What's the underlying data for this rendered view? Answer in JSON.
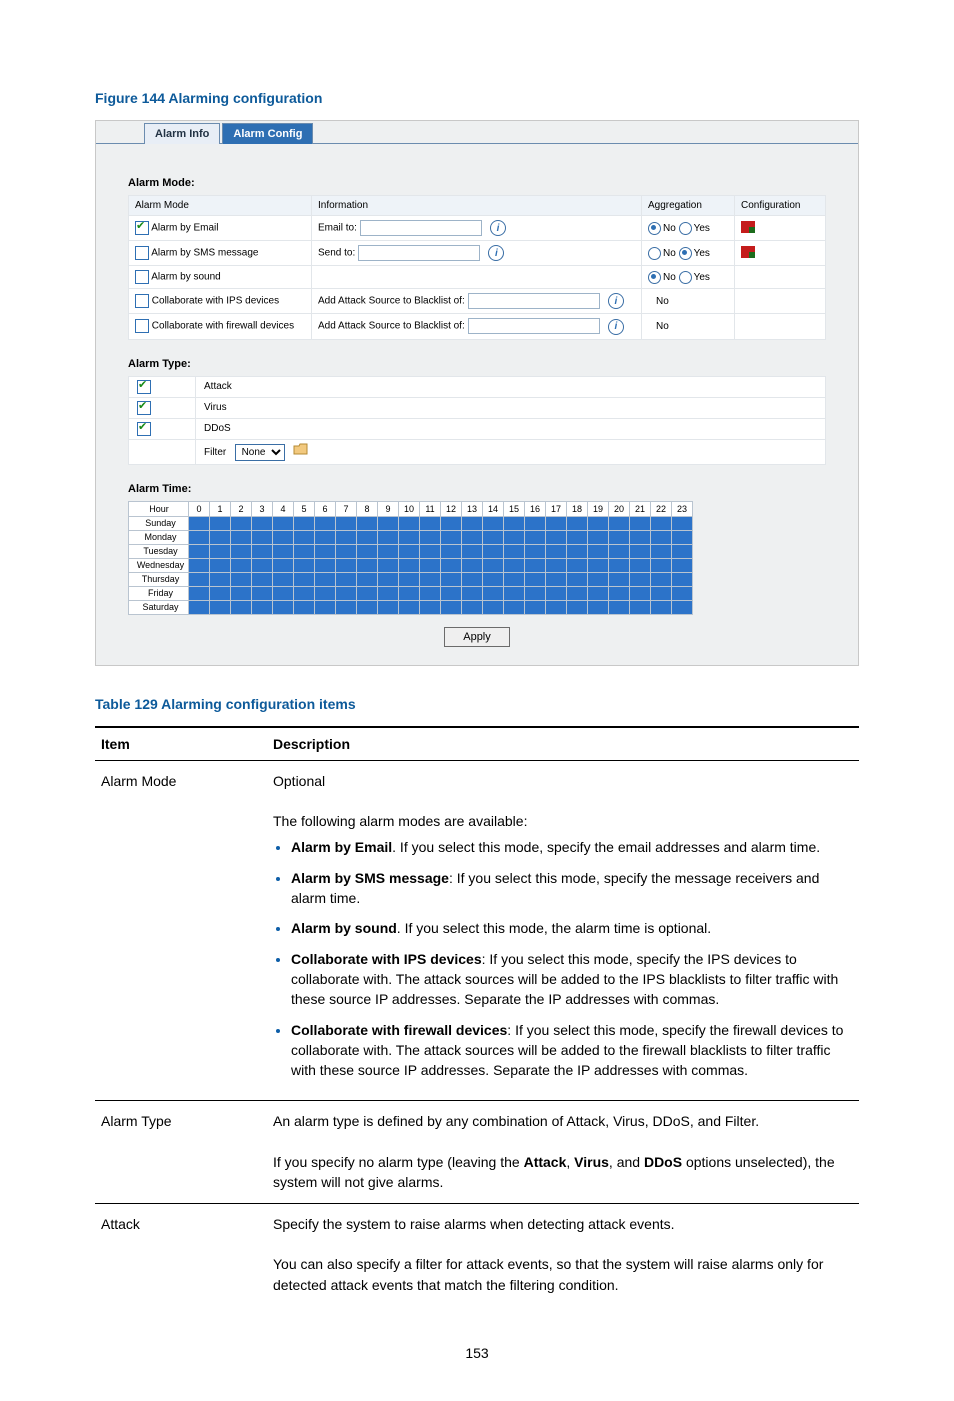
{
  "figure_caption": "Figure 144 Alarming configuration",
  "tabs": {
    "info": "Alarm Info",
    "config": "Alarm Config"
  },
  "mode_section": "Alarm Mode:",
  "mode_header": {
    "col1": "Alarm Mode",
    "col2": "Information",
    "col3": "Aggregation",
    "col4": "Configuration"
  },
  "modes": {
    "email": {
      "label": "Alarm by Email",
      "info_label": "Email to:",
      "agg_no": "No",
      "agg_yes": "Yes"
    },
    "sms": {
      "label": "Alarm by SMS message",
      "info_label": "Send to:",
      "agg_no": "No",
      "agg_yes": "Yes"
    },
    "sound": {
      "label": "Alarm by sound",
      "agg_no": "No",
      "agg_yes": "Yes"
    },
    "ips": {
      "label": "Collaborate with IPS devices",
      "info_label": "Add Attack Source to Blacklist of:",
      "agg": "No"
    },
    "fw": {
      "label": "Collaborate with firewall devices",
      "info_label": "Add Attack Source to Blacklist of:",
      "agg": "No"
    }
  },
  "type_section": "Alarm Type:",
  "types": {
    "attack": "Attack",
    "virus": "Virus",
    "ddos": "DDoS",
    "filter": "Filter",
    "filter_option": "None"
  },
  "time_section": "Alarm Time:",
  "time_header": "Hour",
  "hours": [
    "0",
    "1",
    "2",
    "3",
    "4",
    "5",
    "6",
    "7",
    "8",
    "9",
    "10",
    "11",
    "12",
    "13",
    "14",
    "15",
    "16",
    "17",
    "18",
    "19",
    "20",
    "21",
    "22",
    "23"
  ],
  "days": [
    "Sunday",
    "Monday",
    "Tuesday",
    "Wednesday",
    "Thursday",
    "Friday",
    "Saturday"
  ],
  "apply": "Apply",
  "table_caption": "Table 129 Alarming configuration items",
  "table_header": {
    "item": "Item",
    "desc": "Description"
  },
  "row_mode": {
    "item": "Alarm Mode",
    "p1": "Optional",
    "p2": "The following alarm modes are available:",
    "b1a": "Alarm by Email",
    "b1b": ". If you select this mode, specify the email addresses and alarm time.",
    "b2a": "Alarm by SMS message",
    "b2b": ": If you select this mode, specify the message receivers and alarm time.",
    "b3a": "Alarm by sound",
    "b3b": ". If you select this mode, the alarm time is optional.",
    "b4a": "Collaborate with IPS devices",
    "b4b": ": If you select this mode, specify the IPS devices to collaborate with. The attack sources will be added to the IPS blacklists to filter traffic with these source IP addresses. Separate the IP addresses with commas.",
    "b5a": "Collaborate with firewall devices",
    "b5b": ": If you select this mode, specify the firewall devices to collaborate with. The attack sources will be added to the firewall blacklists to filter traffic with these source IP addresses. Separate the IP addresses with commas."
  },
  "row_type": {
    "item": "Alarm Type",
    "p1": "An alarm type is defined by any combination of Attack, Virus, DDoS, and Filter.",
    "p2a": "If you specify no alarm type (leaving the ",
    "p2b": "Attack",
    "p2c": ", ",
    "p2d": "Virus",
    "p2e": ", and ",
    "p2f": "DDoS",
    "p2g": " options unselected), the system will not give alarms."
  },
  "row_attack": {
    "item": "Attack",
    "p1": "Specify the system to raise alarms when detecting attack events.",
    "p2": "You can also specify a filter for attack events, so that the system will raise alarms only for detected attack events that match the filtering condition."
  },
  "page_number": "153"
}
